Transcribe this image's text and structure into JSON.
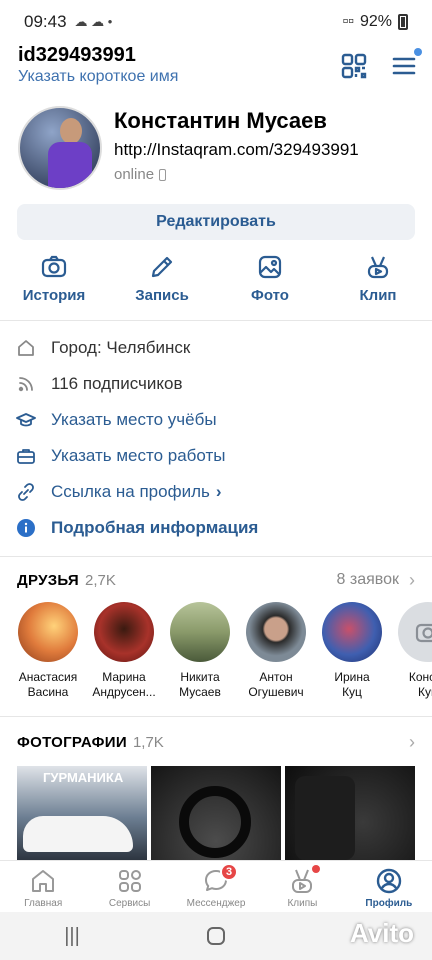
{
  "status_bar": {
    "time": "09:43",
    "battery": "92%"
  },
  "header": {
    "user_id": "id329493991",
    "short_name_link": "Указать короткое имя"
  },
  "profile": {
    "name": "Константин Мусаев",
    "link": "http://Instaqram.com/329493991",
    "status": "online"
  },
  "edit_button": "Редактировать",
  "actions": [
    {
      "label": "История",
      "icon": "camera-icon"
    },
    {
      "label": "Запись",
      "icon": "pencil-icon"
    },
    {
      "label": "Фото",
      "icon": "image-icon"
    },
    {
      "label": "Клип",
      "icon": "clip-icon"
    }
  ],
  "info": {
    "city": "Город: Челябинск",
    "followers": "116 подписчиков",
    "study": "Указать место учёбы",
    "work": "Указать место работы",
    "profile_link": "Ссылка на профиль",
    "details": "Подробная информация"
  },
  "friends": {
    "title": "ДРУЗЬЯ",
    "count": "2,7K",
    "requests": "8 заявок",
    "items": [
      {
        "first": "Анастасия",
        "last": "Васина",
        "color": "#e07b3c"
      },
      {
        "first": "Марина",
        "last": "Андрусен...",
        "color": "#a8322a"
      },
      {
        "first": "Никита",
        "last": "Мусаев",
        "color": "#8a9a6a"
      },
      {
        "first": "Антон",
        "last": "Огушевич",
        "color": "#7d8a96"
      },
      {
        "first": "Ирина",
        "last": "Куц",
        "color": "#3f5fb0"
      },
      {
        "first": "Конста",
        "last": "Куц",
        "color": "#c9ccd0"
      }
    ]
  },
  "photos": {
    "title": "ФОТОГРАФИИ",
    "count": "1,7K",
    "sign_text": "ГУРМАНИКА"
  },
  "bottom_nav": [
    {
      "label": "Главная"
    },
    {
      "label": "Сервисы"
    },
    {
      "label": "Мессенджер",
      "badge": "3"
    },
    {
      "label": "Клипы"
    },
    {
      "label": "Профиль"
    }
  ],
  "watermark": "Avito"
}
